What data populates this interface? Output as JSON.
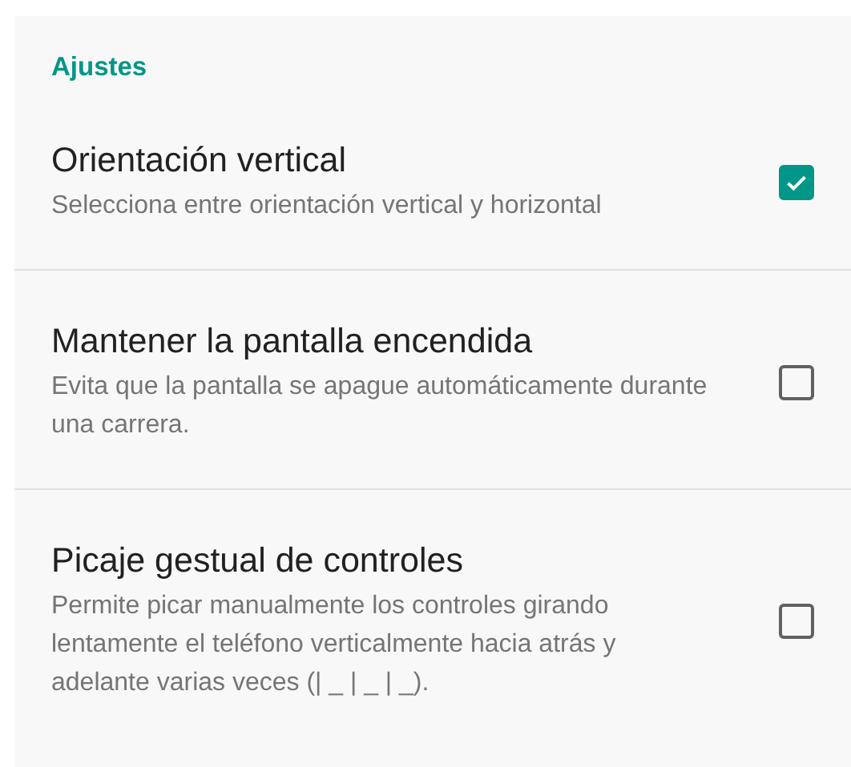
{
  "section_title": "Ajustes",
  "settings": [
    {
      "title": "Orientación vertical",
      "description": "Selecciona entre orientación vertical y horizontal",
      "checked": true
    },
    {
      "title": "Mantener la pantalla encendida",
      "description": "Evita que la pantalla se apague automáticamente durante una carrera.",
      "checked": false
    },
    {
      "title": "Picaje gestual de controles",
      "description": "Permite picar manualmente los controles girando lentamente el teléfono verticalmente hacia atrás y adelante varias veces (| _ | _ | _).",
      "checked": false
    }
  ]
}
